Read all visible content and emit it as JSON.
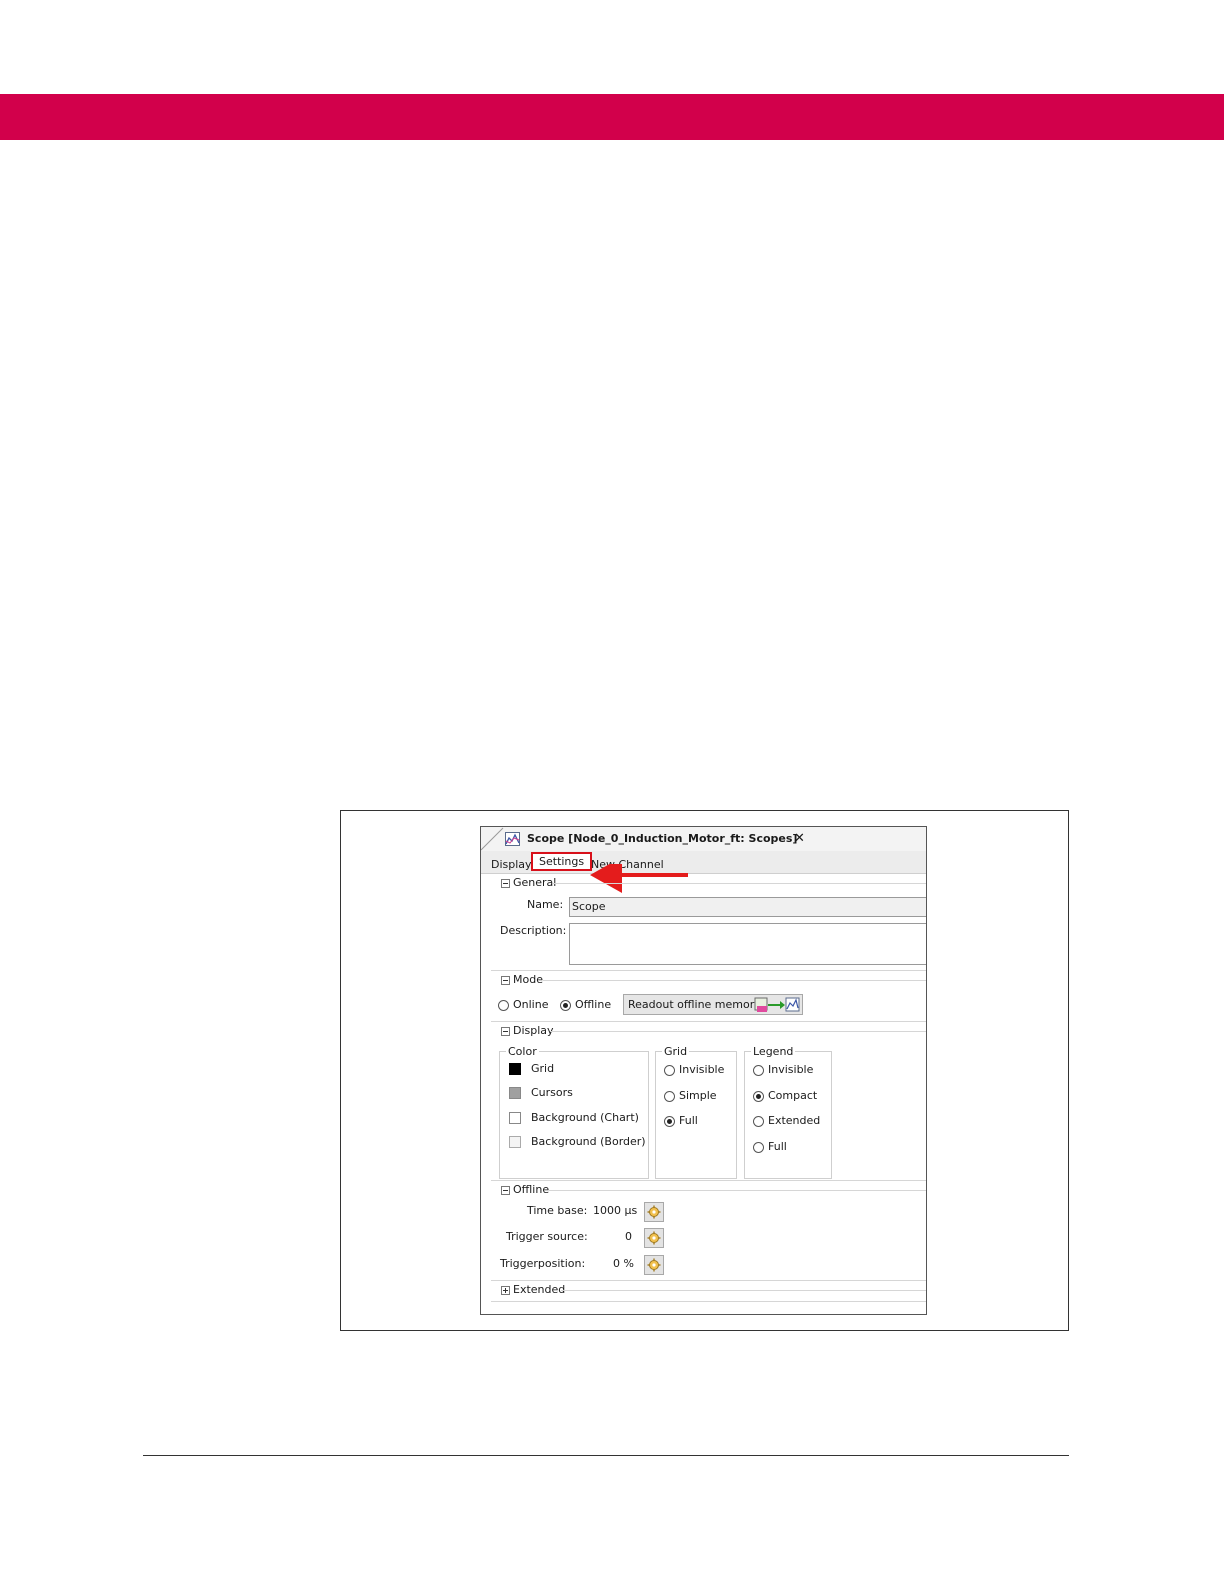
{
  "colors": {
    "band": "#d2004b",
    "highlight": "#d8101a"
  },
  "window": {
    "title": "Scope [Node_0_Induction_Motor_ft: Scopes]",
    "close_glyph": "✕"
  },
  "tabs": [
    {
      "label": "Display"
    },
    {
      "label": "Settings",
      "active": true
    },
    {
      "label": "New Channel"
    }
  ],
  "sections": {
    "general": {
      "title": "General",
      "name_label": "Name:",
      "name_value": "Scope",
      "description_label": "Description:",
      "description_value": ""
    },
    "mode": {
      "title": "Mode",
      "options": [
        {
          "label": "Online",
          "selected": false
        },
        {
          "label": "Offline",
          "selected": true
        }
      ],
      "readout_button": "Readout offline memory"
    },
    "display": {
      "title": "Display",
      "color": {
        "title": "Color",
        "items": [
          {
            "label": "Grid",
            "swatch": "#000000"
          },
          {
            "label": "Cursors",
            "swatch": "#a0a0a0"
          },
          {
            "label": "Background (Chart)",
            "swatch": "#ffffff"
          },
          {
            "label": "Background (Border)",
            "swatch": "#f4f4f4"
          }
        ]
      },
      "grid": {
        "title": "Grid",
        "options": [
          {
            "label": "Invisible",
            "selected": false
          },
          {
            "label": "Simple",
            "selected": false
          },
          {
            "label": "Full",
            "selected": true
          }
        ]
      },
      "legend": {
        "title": "Legend",
        "options": [
          {
            "label": "Invisible",
            "selected": false
          },
          {
            "label": "Compact",
            "selected": true
          },
          {
            "label": "Extended",
            "selected": false
          },
          {
            "label": "Full",
            "selected": false
          }
        ]
      }
    },
    "offline": {
      "title": "Offline",
      "rows": [
        {
          "label": "Time base:",
          "value": "1000 µs"
        },
        {
          "label": "Trigger source:",
          "value": "0"
        },
        {
          "label": "Triggerposition:",
          "value": "0 %"
        }
      ]
    },
    "extended": {
      "title": "Extended"
    }
  }
}
